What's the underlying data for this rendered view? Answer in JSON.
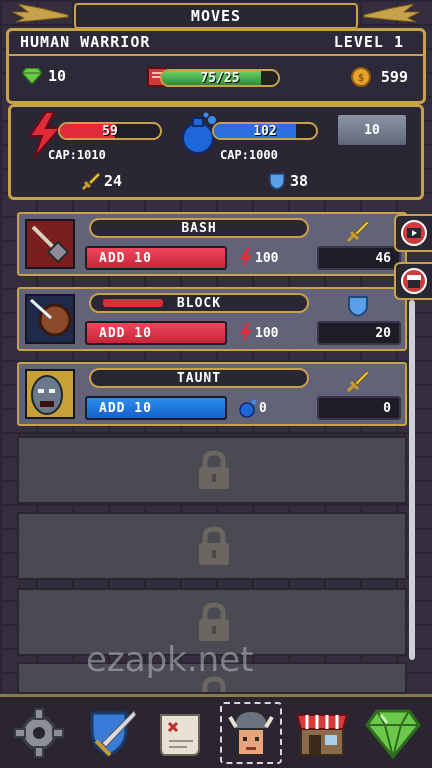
{
  "title": "MOVES",
  "character": {
    "name": "HUMAN WARRIOR",
    "level": "LEVEL 1"
  },
  "stats": {
    "gems": "10",
    "health": {
      "text": "75/25",
      "fill_fraction": 0.85
    },
    "gold": "599"
  },
  "resources": {
    "rage": {
      "value": "59",
      "cap": "CAP:1010",
      "fill_fraction": 0.55
    },
    "mana": {
      "value": "102",
      "cap": "CAP:1000",
      "fill_fraction": 0.8
    },
    "level_button": "10",
    "attack": "24",
    "defense": "38"
  },
  "moves": [
    {
      "name": "BASH",
      "add_label": "ADD 10",
      "cost": "100",
      "value": "46",
      "add_color": "red",
      "type_icon": "sword-icon"
    },
    {
      "name": "BLOCK",
      "add_label": "ADD 10",
      "cost": "100",
      "value": "20",
      "add_color": "red",
      "type_icon": "shield-icon"
    },
    {
      "name": "TAUNT",
      "add_label": "ADD 10",
      "cost": "0",
      "value": "0",
      "add_color": "blue",
      "type_icon": "sword-icon"
    }
  ],
  "locked_slots": 4,
  "watermark": "ezapk.net",
  "nav": [
    "gear-icon",
    "shield-sword-icon",
    "map-scroll-icon",
    "hero-portrait-icon",
    "shop-icon",
    "gem-icon"
  ],
  "colors": {
    "gold": "#c7a24a",
    "red": "#e02b3b",
    "blue": "#2b8ff0",
    "green": "#4cc44c"
  }
}
